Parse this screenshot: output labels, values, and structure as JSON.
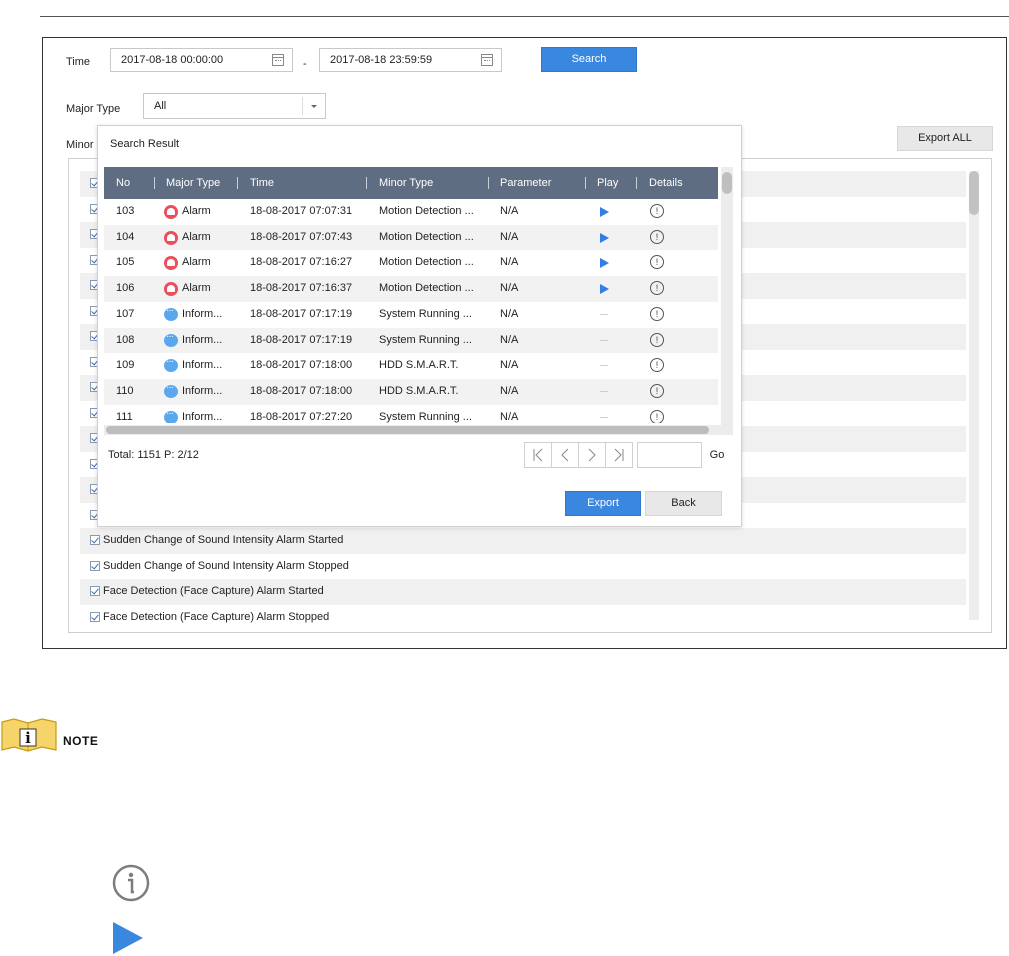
{
  "search_form": {
    "time_label": "Time",
    "start_time": "2017-08-18 00:00:00",
    "range_separator": "-",
    "end_time": "2017-08-18 23:59:59",
    "search_button": "Search",
    "major_type_label": "Major Type",
    "major_type_value": "All",
    "minor_type_label": "Minor",
    "export_all_button": "Export ALL"
  },
  "background_list": {
    "items": [
      "Sudden Change of Sound Intensity Alarm Started",
      "Sudden Change of Sound Intensity Alarm Stopped",
      "Face Detection (Face Capture) Alarm Started",
      "Face Detection (Face Capture) Alarm Stopped"
    ]
  },
  "dialog": {
    "title": "Search Result",
    "columns": [
      "No",
      "Major Type",
      "Time",
      "Minor Type",
      "Parameter",
      "Play",
      "Details"
    ],
    "rows": [
      {
        "no": "103",
        "major": "Alarm",
        "time": "18-08-2017 07:07:31",
        "minor": "Motion Detection ...",
        "param": "N/A",
        "play": "play",
        "icon": "alarm"
      },
      {
        "no": "104",
        "major": "Alarm",
        "time": "18-08-2017 07:07:43",
        "minor": "Motion Detection ...",
        "param": "N/A",
        "play": "play",
        "icon": "alarm"
      },
      {
        "no": "105",
        "major": "Alarm",
        "time": "18-08-2017 07:16:27",
        "minor": "Motion Detection ...",
        "param": "N/A",
        "play": "play",
        "icon": "alarm"
      },
      {
        "no": "106",
        "major": "Alarm",
        "time": "18-08-2017 07:16:37",
        "minor": "Motion Detection ...",
        "param": "N/A",
        "play": "play",
        "icon": "alarm"
      },
      {
        "no": "107",
        "major": "Inform...",
        "time": "18-08-2017 07:17:19",
        "minor": "System Running ...",
        "param": "N/A",
        "play": "none",
        "icon": "info"
      },
      {
        "no": "108",
        "major": "Inform...",
        "time": "18-08-2017 07:17:19",
        "minor": "System Running ...",
        "param": "N/A",
        "play": "none",
        "icon": "info"
      },
      {
        "no": "109",
        "major": "Inform...",
        "time": "18-08-2017 07:18:00",
        "minor": "HDD S.M.A.R.T.",
        "param": "N/A",
        "play": "none",
        "icon": "info"
      },
      {
        "no": "110",
        "major": "Inform...",
        "time": "18-08-2017 07:18:00",
        "minor": "HDD S.M.A.R.T.",
        "param": "N/A",
        "play": "none",
        "icon": "info"
      },
      {
        "no": "111",
        "major": "Inform...",
        "time": "18-08-2017 07:27:20",
        "minor": "System Running ...",
        "param": "N/A",
        "play": "none",
        "icon": "info"
      }
    ],
    "total_text": "Total: 1151  P: 2/12",
    "go_button": "Go",
    "export_button": "Export",
    "back_button": "Back"
  },
  "note": {
    "label": "NOTE",
    "accent_color": "#d4a017"
  },
  "colors": {
    "primary": "#3a87e0",
    "table_header": "#5e6d81",
    "alarm": "#e8505b",
    "info": "#5aa7ee",
    "play": "#2f7fe6"
  }
}
